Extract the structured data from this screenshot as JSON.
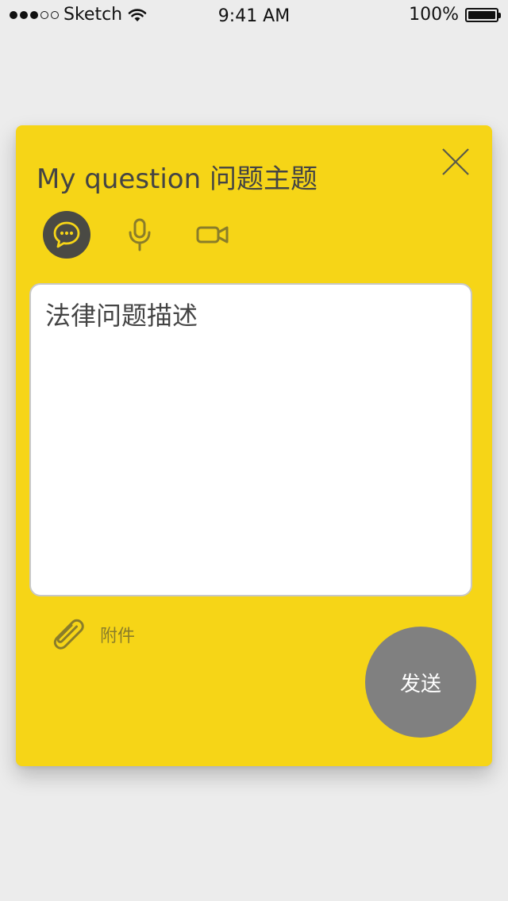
{
  "status_bar": {
    "carrier": "Sketch",
    "time": "9:41 AM",
    "battery": "100%",
    "signal_bars_filled": 3,
    "signal_bars_total": 5
  },
  "card": {
    "title": "My question 问题主题",
    "modes": [
      {
        "name": "text",
        "icon": "chat-bubble-icon",
        "active": true
      },
      {
        "name": "voice",
        "icon": "microphone-icon",
        "active": false
      },
      {
        "name": "video",
        "icon": "video-camera-icon",
        "active": false
      }
    ],
    "description": {
      "placeholder": "法律问题描述",
      "value": ""
    },
    "attachment_label": "附件",
    "send_label": "发送"
  },
  "colors": {
    "card_background": "#f6d517",
    "page_background": "#ececec",
    "send_button": "#808080",
    "active_mode": "#4a4a44",
    "icon_muted": "#8a7d2a"
  }
}
